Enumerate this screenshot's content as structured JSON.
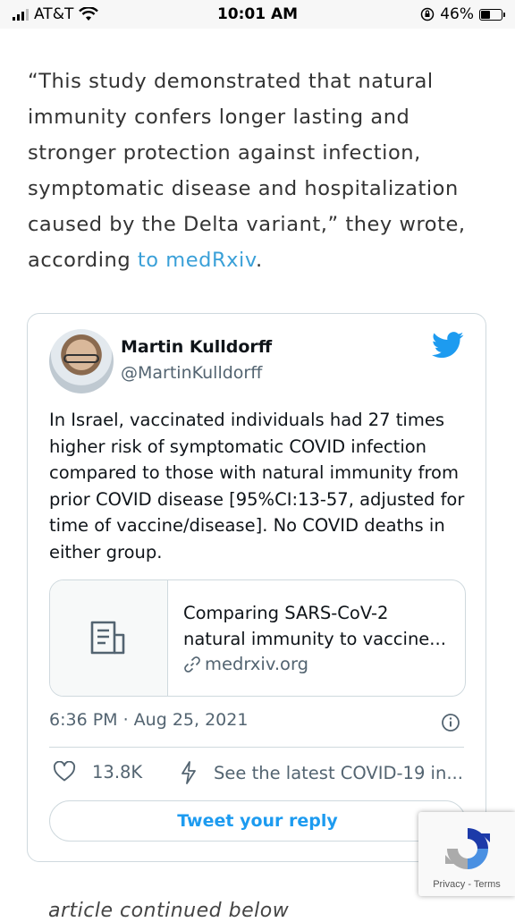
{
  "status_bar": {
    "carrier": "AT&T",
    "time": "10:01 AM",
    "battery_percent": "46%",
    "battery_level": 0.46
  },
  "article": {
    "quote_text": "“This study demonstrated that natural immunity confers longer lasting and stronger protection against infection, symptomatic disease and hospitalization caused by the Delta variant,” they wrote, according ",
    "link_text": "to medRxiv",
    "after_link": ".",
    "continued_text": "article continued below"
  },
  "tweet": {
    "display_name": "Martin Kulldorff",
    "handle": "@MartinKulldorff",
    "text": "In Israel, vaccinated individuals had 27 times higher risk of symptomatic COVID infection compared to those with natural immunity from prior COVID disease [95%CI:13-57, adjusted for time of vaccine/disease]. No COVID deaths in either group.",
    "link_card": {
      "title": "Comparing SARS-CoV-2 natural immunity to vaccine...",
      "domain": "medrxiv.org"
    },
    "timestamp": "6:36 PM · Aug 25, 2021",
    "like_count": "13.8K",
    "latest_text": "See the latest COVID-19 in...",
    "reply_button": "Tweet your reply"
  },
  "recaptcha": {
    "terms": "Privacy - Terms"
  },
  "colors": {
    "link": "#3aa0d8",
    "twitter_blue": "#1d9bf0"
  }
}
